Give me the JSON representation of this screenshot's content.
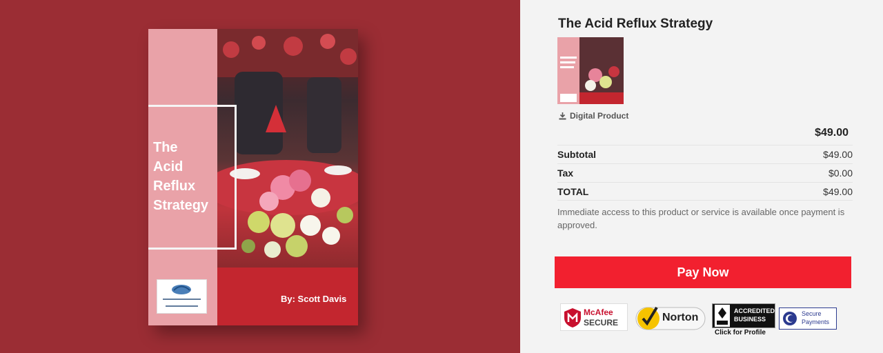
{
  "hero": {
    "book": {
      "title_lines": [
        "The",
        "Acid",
        "Reflux",
        "Strategy"
      ],
      "author": "By: Scott Davis",
      "logo_name": "blue-heron-logo"
    },
    "colors": {
      "background": "#9b2d34",
      "spine": "#e9a2a8",
      "bottom": "#c3262f"
    }
  },
  "checkout": {
    "product_title": "The Acid Reflux Strategy",
    "product_type": "Digital Product",
    "price": "$49.00",
    "totals": [
      {
        "label": "Subtotal",
        "value": "$49.00"
      },
      {
        "label": "Tax",
        "value": "$0.00"
      },
      {
        "label": "TOTAL",
        "value": "$49.00"
      }
    ],
    "notice": "Immediate access to this product or service is available once payment is approved.",
    "pay_label": "Pay Now",
    "accent": "#f2202f"
  },
  "badges": {
    "mcafee": "McAfee",
    "mcafee_sub": "SECURE",
    "norton": "Norton",
    "bbb_line1": "ACCREDITED",
    "bbb_line2": "BUSINESS",
    "bbb_caption": "Click for Profile",
    "secure_line1": "Secure",
    "secure_line2": "Payments"
  }
}
